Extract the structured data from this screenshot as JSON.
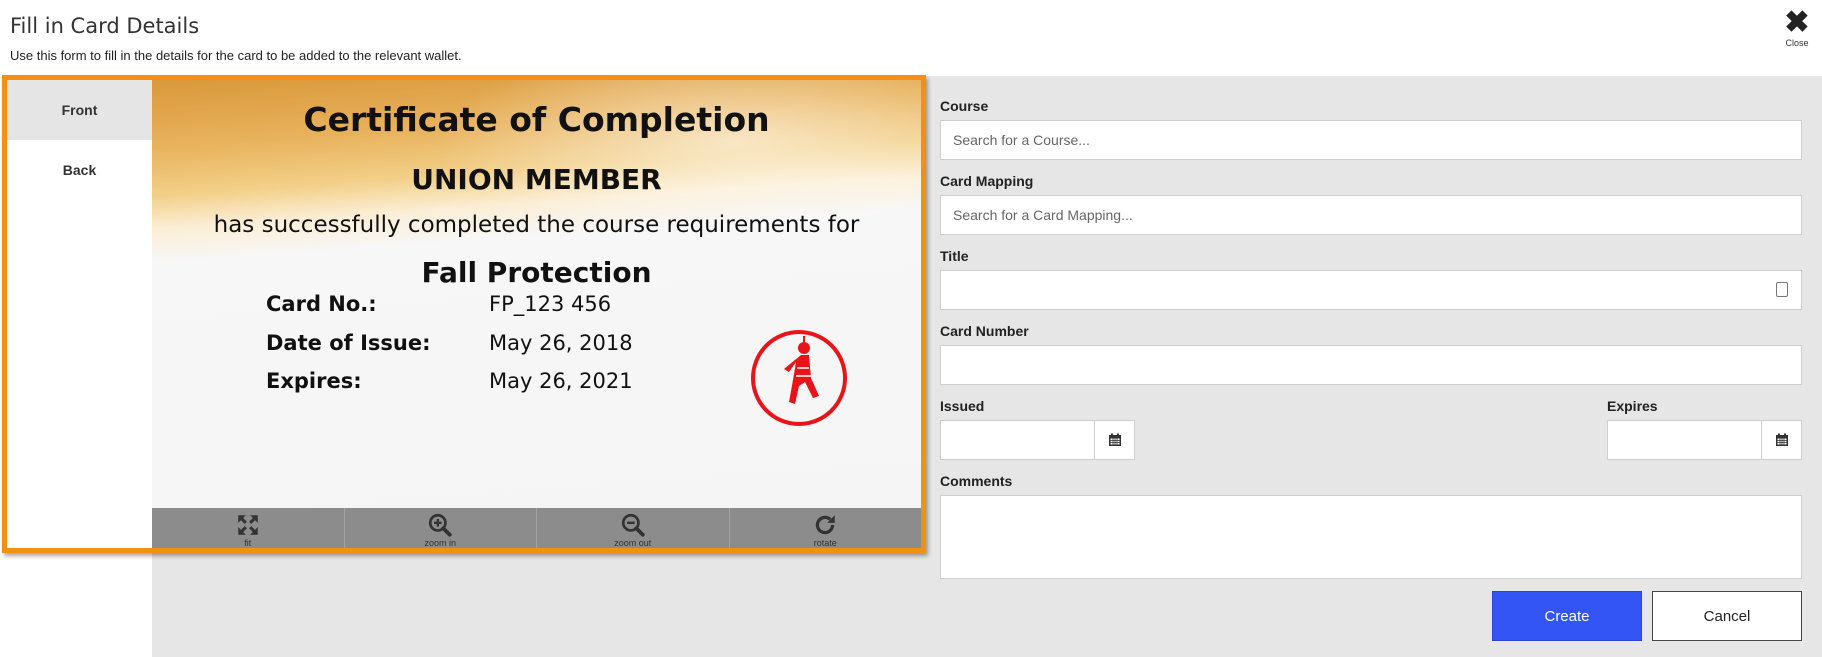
{
  "header": {
    "title": "Fill in Card Details",
    "subtitle": "Use this form to fill in the details for the card to be added to the relevant wallet.",
    "close_label": "Close"
  },
  "viewer": {
    "tabs": [
      {
        "label": "Front",
        "active": true
      },
      {
        "label": "Back",
        "active": false
      }
    ],
    "toolbar": [
      {
        "label": "fit",
        "icon": "expand-icon"
      },
      {
        "label": "zoom in",
        "icon": "zoom-in-icon"
      },
      {
        "label": "zoom out",
        "icon": "zoom-out-icon"
      },
      {
        "label": "rotate",
        "icon": "rotate-icon"
      }
    ],
    "card": {
      "heading": "Certificate of Completion",
      "name": "UNION MEMBER",
      "statement": "has successfully completed the course requirements for",
      "course": "Fall Protection",
      "rows": [
        {
          "label": "Card No.:",
          "value": "FP_123 456"
        },
        {
          "label": "Date of Issue:",
          "value": "May 26, 2018"
        },
        {
          "label": "Expires:",
          "value": "May 26, 2021"
        }
      ],
      "badge_icon": "fall-protection-worker-icon",
      "badge_color": "#e8141a"
    },
    "accent_color": "#f29110"
  },
  "form": {
    "course": {
      "label": "Course",
      "placeholder": "Search for a Course...",
      "value": ""
    },
    "card_mapping": {
      "label": "Card Mapping",
      "placeholder": "Search for a Card Mapping...",
      "value": ""
    },
    "title": {
      "label": "Title",
      "value": ""
    },
    "card_number": {
      "label": "Card Number",
      "value": ""
    },
    "issued": {
      "label": "Issued",
      "value": ""
    },
    "expires": {
      "label": "Expires",
      "value": ""
    },
    "comments": {
      "label": "Comments",
      "value": ""
    },
    "create_label": "Create",
    "cancel_label": "Cancel",
    "create_color": "#3355f5"
  }
}
